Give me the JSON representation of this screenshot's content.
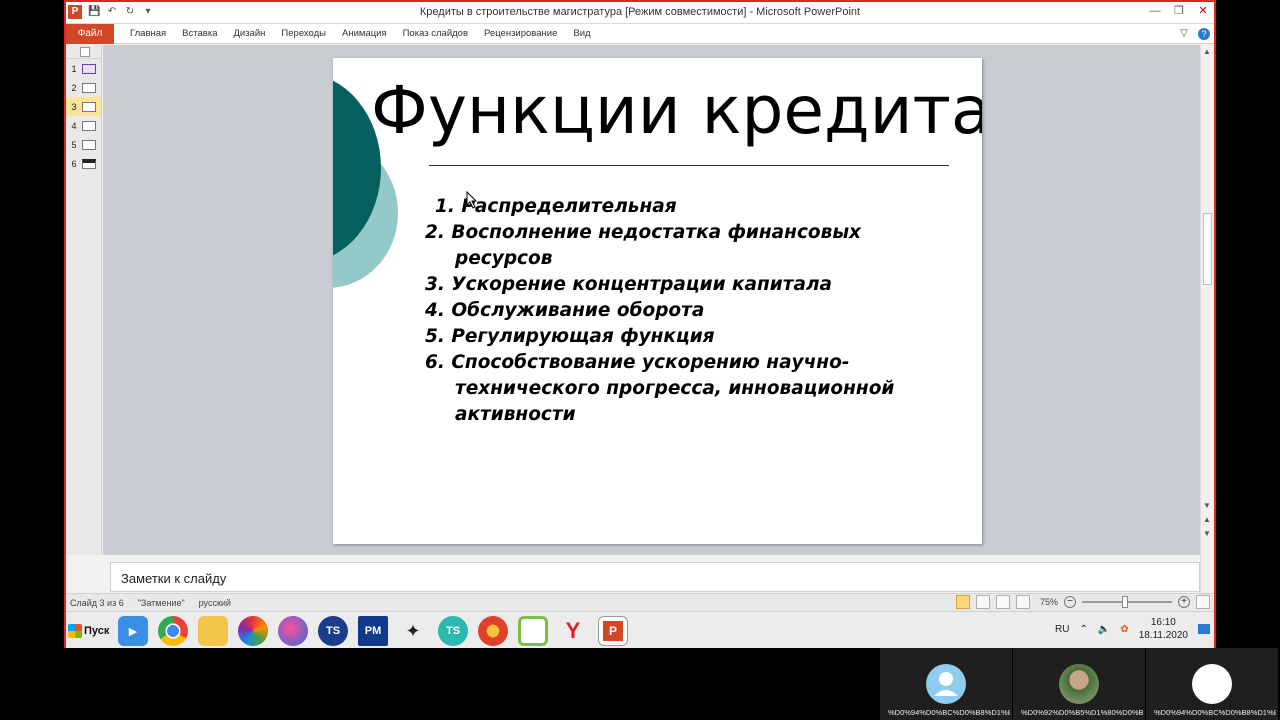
{
  "window": {
    "title": "Кредиты в строительстве магистратура [Режим совместимости]  -  Microsoft PowerPoint",
    "app_icon_letter": "P"
  },
  "ribbon": {
    "file_tab": "Файл",
    "tabs": [
      "Главная",
      "Вставка",
      "Дизайн",
      "Переходы",
      "Анимация",
      "Показ слайдов",
      "Рецензирование",
      "Вид"
    ]
  },
  "thumbnails": {
    "numbers": [
      "1",
      "2",
      "3",
      "4",
      "5",
      "6"
    ],
    "active_index": 3
  },
  "slide": {
    "title": "Функции кредита",
    "items": [
      "1. Распределительная",
      "2. Восполнение недостатка финансовых ресурсов",
      "3. Ускорение концентрации капитала",
      "4. Обслуживание оборота",
      "5. Регулирующая функция",
      "6. Способствование ускорению научно-технического прогресса, инновационной активности"
    ],
    "colors": {
      "dark_circle": "#066060",
      "light_circle": "#93c9c9"
    }
  },
  "notes": {
    "placeholder": "Заметки к слайду"
  },
  "status": {
    "slide_counter": "Слайд 3 из 6",
    "theme": "\"Затмение\"",
    "language": "русский",
    "zoom": "75%"
  },
  "taskbar": {
    "start_label": "Пуск",
    "icons": [
      "media-player-icon",
      "chrome-icon",
      "folder-icon",
      "app-pinwheel-icon",
      "app-pink-icon",
      "ts-app-icon",
      "pm-app-icon",
      "bird-app-icon",
      "ts-teal-icon",
      "parrot-app-icon",
      "download-app-icon",
      "yandex-browser-icon",
      "powerpoint-icon"
    ],
    "yandex_label": "Y",
    "ts_label": "TS",
    "pm_label": "PM",
    "powerpoint_label": "P",
    "language": "RU",
    "clock_time": "16:10",
    "clock_date": "18.11.2020"
  },
  "participants": [
    {
      "name": "%D0%94%D0%BC%D0%B8%D1%8...",
      "avatar": "default-avatar"
    },
    {
      "name": "%D0%92%D0%B5%D1%80%D0%B0...",
      "avatar": "photo-avatar"
    },
    {
      "name": "%D0%94%D0%BC%D0%B8%D1%8...",
      "avatar": "white-avatar"
    }
  ]
}
